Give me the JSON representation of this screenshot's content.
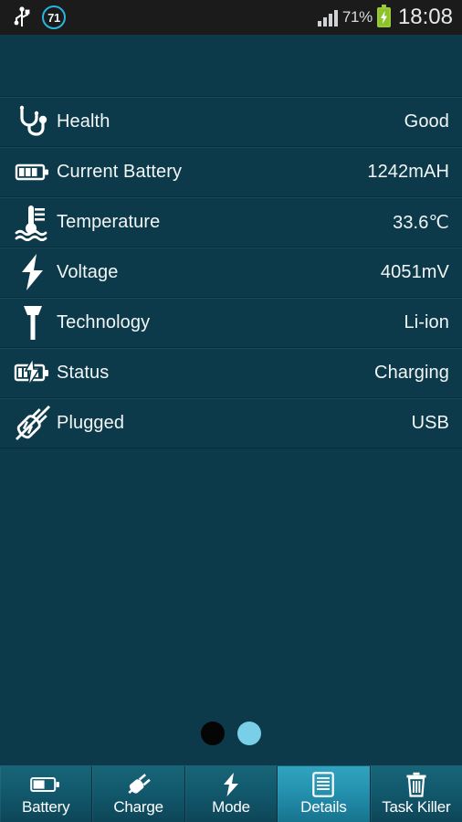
{
  "statusbar": {
    "usb_icon": "usb-icon",
    "notification_badge": "71",
    "signal_icon": "signal-bars-icon",
    "battery_percent": "71%",
    "battery_icon": "battery-charging-icon",
    "time": "18:08"
  },
  "details": {
    "rows": [
      {
        "icon": "stethoscope-icon",
        "label": "Health",
        "value": "Good"
      },
      {
        "icon": "battery-level-icon",
        "label": "Current Battery",
        "value": "1242mAH"
      },
      {
        "icon": "thermometer-icon",
        "label": "Temperature",
        "value": "33.6℃"
      },
      {
        "icon": "lightning-bolt-icon",
        "label": "Voltage",
        "value": "4051mV"
      },
      {
        "icon": "hammer-icon",
        "label": "Technology",
        "value": "Li-ion"
      },
      {
        "icon": "battery-charging-icon",
        "label": "Status",
        "value": "Charging"
      },
      {
        "icon": "plug-icon",
        "label": "Plugged",
        "value": "USB"
      }
    ]
  },
  "pager": {
    "dots": [
      {
        "state": "inactive"
      },
      {
        "state": "active"
      }
    ]
  },
  "tabbar": {
    "tabs": [
      {
        "icon": "battery-icon",
        "label": "Battery",
        "active": false
      },
      {
        "icon": "plug-icon",
        "label": "Charge",
        "active": false
      },
      {
        "icon": "bolt-icon",
        "label": "Mode",
        "active": false
      },
      {
        "icon": "document-list-icon",
        "label": "Details",
        "active": true
      },
      {
        "icon": "trash-icon",
        "label": "Task Killer",
        "active": false
      }
    ]
  },
  "colors": {
    "background": "#0d3a4a",
    "statusbar_bg": "#1b1b1b",
    "accent": "#31a3bf",
    "badge_ring": "#27b6e0",
    "battery_green": "#8bc329",
    "dot_active": "#79cfe8",
    "divider": "#0a2b37",
    "text": "#f2f6f7"
  }
}
